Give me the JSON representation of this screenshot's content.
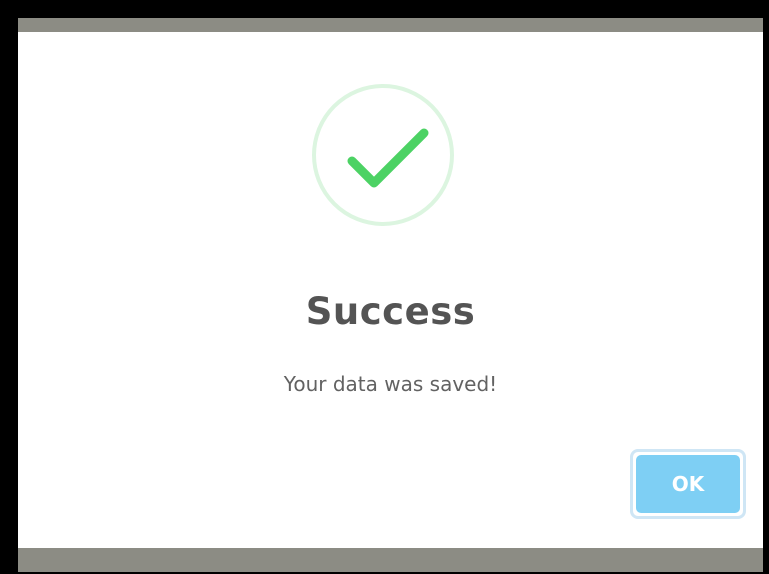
{
  "dialog": {
    "icon": "check-circle-icon",
    "title": "Success",
    "message": "Your data was saved!",
    "ok_label": "OK"
  },
  "colors": {
    "success_green": "#4cd264",
    "icon_ring": "#dcf5e0",
    "ok_button": "#7ecff4",
    "overlay": "#8c8c84",
    "title_text": "#545454"
  }
}
